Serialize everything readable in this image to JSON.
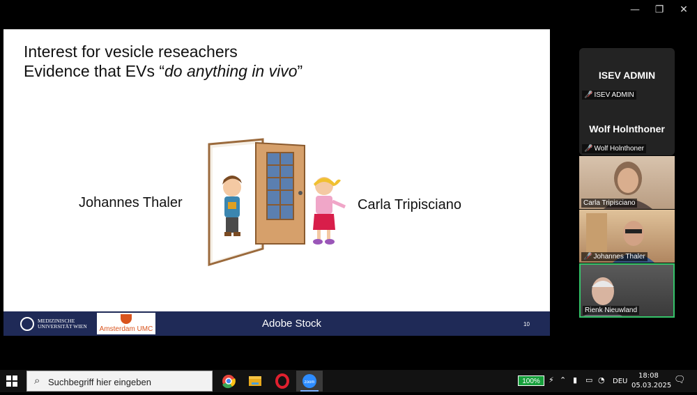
{
  "window": {
    "minimize": "—",
    "restore": "❐",
    "close": "✕"
  },
  "slide": {
    "title_line1": "Interest for vesicle reseachers",
    "title_line2_prefix": "Evidence that EVs “",
    "title_line2_italic": "do anything in vivo",
    "title_line2_suffix": "”",
    "name_left": "Johannes Thaler",
    "name_right": "Carla Tripisciano",
    "footer": {
      "logo1_line1": "MEDIZINISCHE",
      "logo1_line2": "UNIVERSITÄT WIEN",
      "logo2": "Amsterdam UMC",
      "caption": "Adobe Stock",
      "page_number": "10"
    }
  },
  "participants": {
    "panel": [
      {
        "name": "ISEV ADMIN",
        "label": "ISEV ADMIN",
        "muted": true
      },
      {
        "name": "Wolf Holnthoner",
        "label": "Wolf Holnthoner",
        "muted": true
      }
    ],
    "videos": [
      {
        "label": "Carla Tripisciano",
        "muted": false,
        "active": false
      },
      {
        "label": "Johannes Thaler",
        "muted": true,
        "active": false
      },
      {
        "label": "Rienk Nieuwland",
        "muted": false,
        "active": true
      }
    ]
  },
  "taskbar": {
    "search_placeholder": "Suchbegriff hier eingeben",
    "apps": [
      "chrome-icon",
      "file-explorer-icon",
      "opera-icon",
      "zoom-icon"
    ],
    "zoom_label": "zoom",
    "battery": "100%",
    "language": "DEU",
    "time": "18:08",
    "date": "05.03.2025"
  },
  "colors": {
    "slide_footer": "#1f2a57",
    "active_speaker": "#35c46a",
    "amc_orange": "#d9541e"
  }
}
